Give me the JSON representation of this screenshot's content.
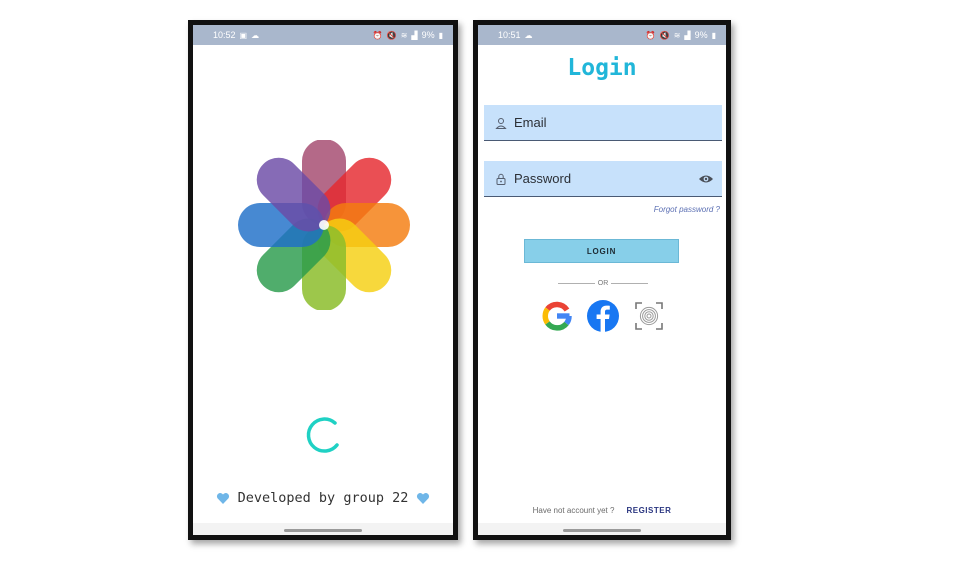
{
  "splash_screen": {
    "status_bar": {
      "time": "10:52",
      "battery": "9%"
    },
    "developer_line": "Developed by group 22",
    "icons": [
      "photos-flower-logo",
      "loading-spinner",
      "blue-heart-icon"
    ],
    "colors": {
      "spinner": "#1fd1c4"
    }
  },
  "login_screen": {
    "status_bar": {
      "time": "10:51",
      "battery": "9%"
    },
    "title": "Login",
    "email_placeholder": "Email",
    "password_placeholder": "Password",
    "forgot_password": "Forgot password ?",
    "login_button": "LOGIN",
    "divider": "OR",
    "social_logins": [
      "google",
      "facebook",
      "fingerprint"
    ],
    "footer_question": "Have not account yet ?",
    "register_link": "REGISTER",
    "colors": {
      "title": "#21b6d9",
      "field_bg": "#c7e1fb",
      "button_bg": "#87cfe9",
      "register": "#2a3680"
    }
  }
}
